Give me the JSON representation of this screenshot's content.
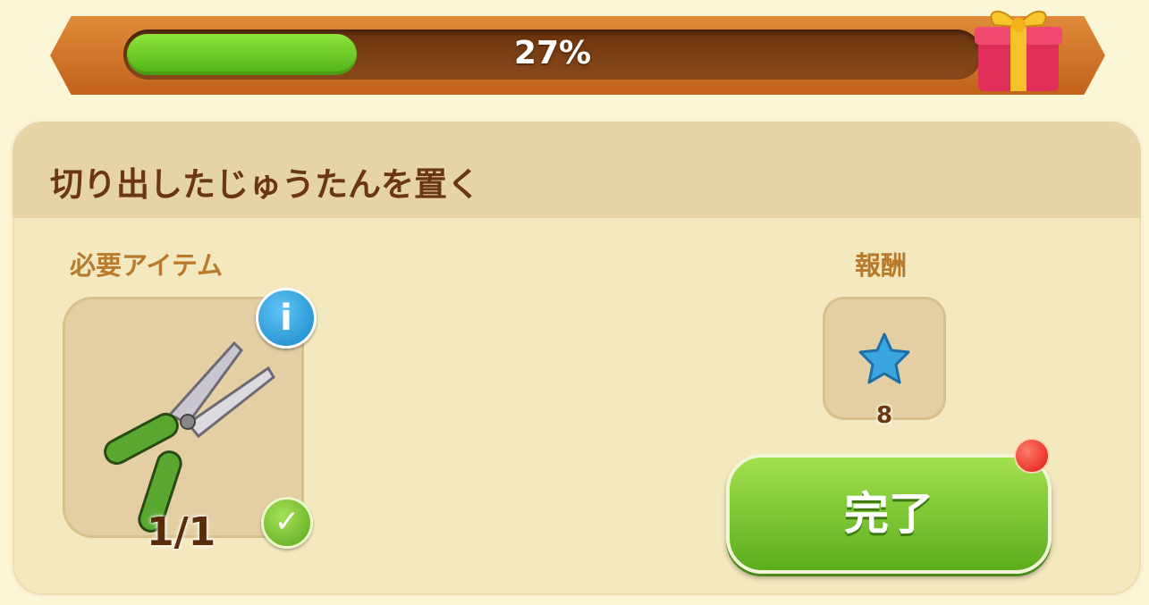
{
  "progress": {
    "percent_label": "27%",
    "value": 0.27
  },
  "task": {
    "title": "切り出したじゅうたんを置く"
  },
  "required": {
    "label": "必要アイテム",
    "count_label": "1/1",
    "item_icon": "pruning-shears-icon",
    "info_icon_glyph": "i",
    "check_glyph": "✓"
  },
  "reward": {
    "label": "報酬",
    "icon": "blue-star-icon",
    "amount": "8"
  },
  "actions": {
    "complete_label": "完了"
  },
  "colors": {
    "progress_fill": "#6cc92a",
    "button": "#7cc634",
    "title": "#6b3712",
    "label": "#b87a2c"
  }
}
